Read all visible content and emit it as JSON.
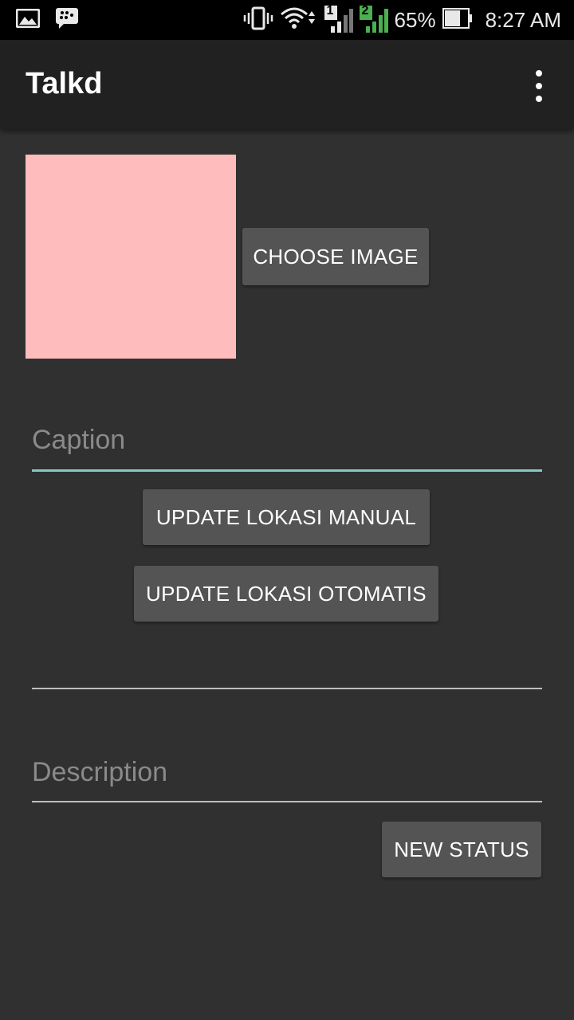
{
  "status_bar": {
    "battery_percent": "65%",
    "time": "8:27 AM",
    "sim1_label": "1",
    "sim2_label": "2",
    "left_icons": [
      "gallery-icon",
      "bbm-icon"
    ],
    "right_icons": [
      "vibrate-icon",
      "wifi-icon",
      "signal-sim1-icon",
      "signal-sim2-icon",
      "battery-icon"
    ]
  },
  "toolbar": {
    "title": "Talkd",
    "menu_icon": "overflow-menu-icon"
  },
  "form": {
    "choose_image_label": "CHOOSE IMAGE",
    "caption_placeholder": "Caption",
    "update_manual_label": "UPDATE LOKASI MANUAL",
    "update_auto_label": "UPDATE LOKASI OTOMATIS",
    "location_value": "",
    "description_placeholder": "Description",
    "new_status_label": "NEW STATUS"
  },
  "colors": {
    "background": "#303030",
    "toolbar": "#212121",
    "button": "#545454",
    "image_placeholder": "#ffbcbc",
    "focused_underline": "#80cbc4",
    "sim2_accent": "#4caf50"
  }
}
